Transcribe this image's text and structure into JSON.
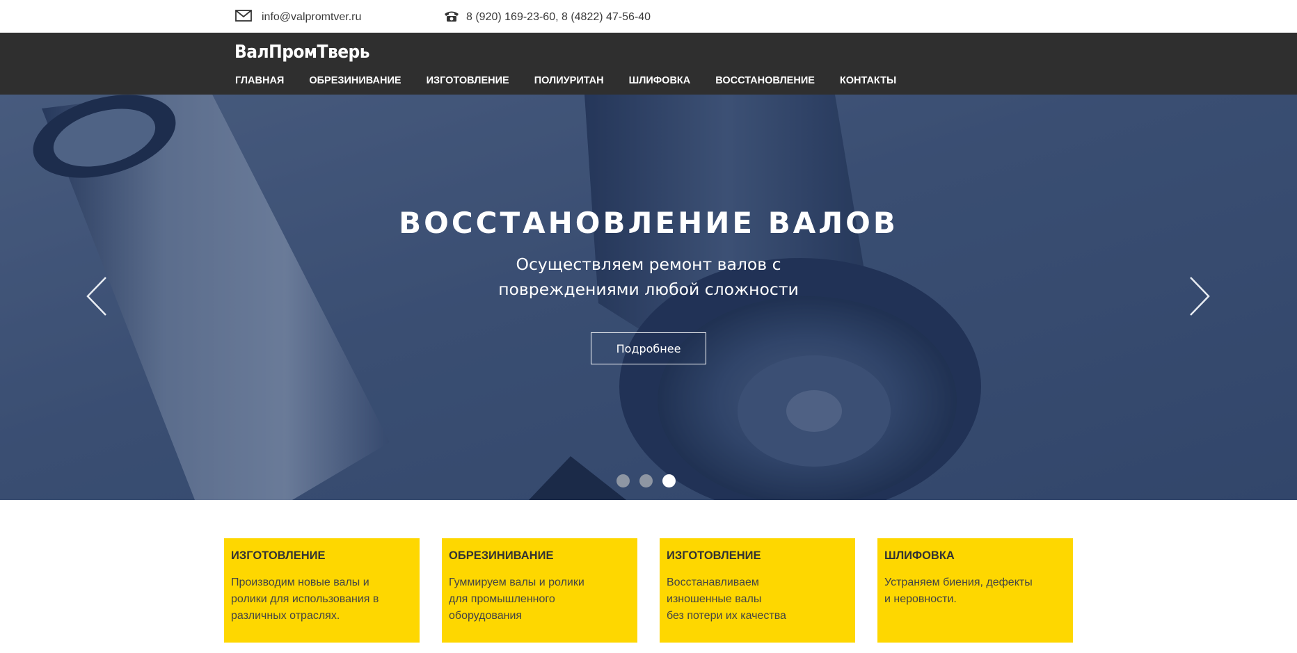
{
  "contacts": {
    "email": "info@valpromtver.ru",
    "phone": "8 (920) 169-23-60, 8 (4822) 47-56-40",
    "email_icon": "envelope-icon",
    "phone_icon": "telephone-icon"
  },
  "header": {
    "logo": "ВалПромТверь",
    "nav": [
      {
        "label": "ГЛАВНАЯ"
      },
      {
        "label": "ОБРЕЗИНИВАНИЕ"
      },
      {
        "label": "ИЗГОТОВЛЕНИЕ"
      },
      {
        "label": "ПОЛИУРИТАН"
      },
      {
        "label": "ШЛИФОВКА"
      },
      {
        "label": "ВОССТАНОВЛЕНИЕ"
      },
      {
        "label": "КОНТАКТЫ"
      }
    ]
  },
  "hero": {
    "title": "ВОССТАНОВЛЕНИЕ ВАЛОВ",
    "subtitle": "Осуществляем ремонт валов с\nповреждениями любой сложности",
    "button": "Подробнее",
    "prev_icon": "chevron-left-icon",
    "next_icon": "chevron-right-icon",
    "slides_total": 3,
    "active_slide": 3
  },
  "cards": [
    {
      "title": "ИЗГОТОВЛЕНИЕ",
      "text": "Производим новые валы и\nролики для использования в\nразличных отраслях."
    },
    {
      "title": "ОБРЕЗИНИВАНИЕ",
      "text": "Гуммируем валы и ролики\nдля промышленного\nоборудования"
    },
    {
      "title": "ИЗГОТОВЛЕНИЕ",
      "text": "Восстанавливаем\nизношенные валы\nбез потери их качества"
    },
    {
      "title": "ШЛИФОВКА",
      "text": "Устраняем биения, дефекты\nи неровности."
    }
  ],
  "colors": {
    "header_bg": "#2f2f2f",
    "card_bg": "#fed700",
    "hero_tint": "#2b4470"
  }
}
